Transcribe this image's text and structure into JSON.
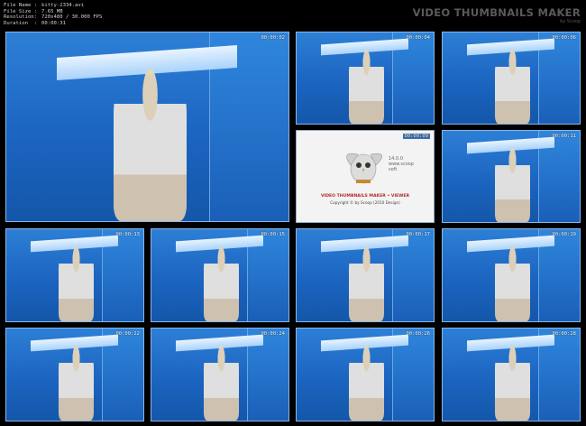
{
  "file_info": [
    {
      "key": "File Name",
      "value": "kitty-2334.avi"
    },
    {
      "key": "File Size",
      "value": "7.65 MB"
    },
    {
      "key": "Resolution",
      "value": "720x480 / 30.000 FPS"
    },
    {
      "key": "Duration",
      "value": "00:00:31"
    }
  ],
  "brand": {
    "title": "VIDEO THUMBNAILS MAKER",
    "subtitle": "by Scoop"
  },
  "viewer": {
    "version": "14.0.0",
    "version_note": "www.scoop",
    "version_note2": "soft",
    "title": "VIDEO THUMBNAILS MAKER • VIEWER",
    "copyright": "Copyright © by Scoop (2010 Design)"
  },
  "thumbnails": [
    {
      "time": "00:00:02"
    },
    {
      "time": "00:00:04"
    },
    {
      "time": "00:00:06"
    },
    {
      "time": "00:00:09"
    },
    {
      "time": "00:00:11"
    },
    {
      "time": "00:00:13"
    },
    {
      "time": "00:00:15"
    },
    {
      "time": "00:00:17"
    },
    {
      "time": "00:00:19"
    },
    {
      "time": "00:00:22"
    },
    {
      "time": "00:00:24"
    },
    {
      "time": "00:00:26"
    },
    {
      "time": "00:00:28"
    }
  ]
}
